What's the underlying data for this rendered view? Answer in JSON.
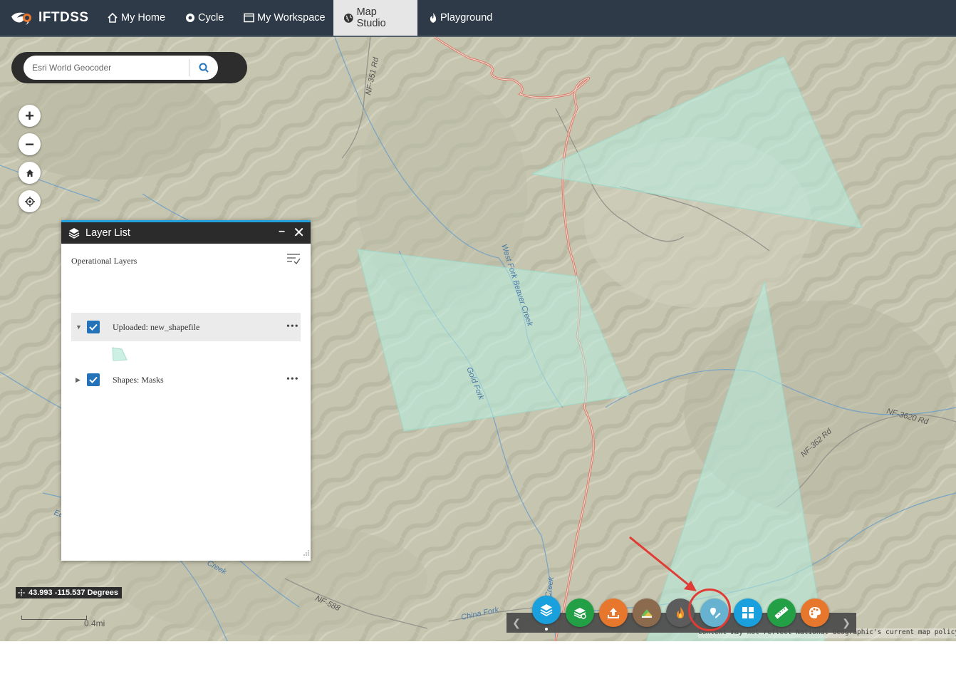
{
  "nav": {
    "brand": "IFTDSS",
    "items": [
      {
        "label": "My Home",
        "icon": "home-icon"
      },
      {
        "label": "Cycle",
        "icon": "cycle-icon"
      },
      {
        "label": "My Workspace",
        "icon": "window-icon"
      },
      {
        "label": "Map Studio",
        "icon": "globe-icon",
        "active": true
      },
      {
        "label": "Playground",
        "icon": "flame-icon"
      }
    ]
  },
  "search": {
    "placeholder": "Esri World Geocoder"
  },
  "map_controls": [
    {
      "name": "zoom-in-button",
      "glyph": "+"
    },
    {
      "name": "zoom-out-button",
      "glyph": "−"
    },
    {
      "name": "home-extent-button",
      "icon": "home-icon"
    },
    {
      "name": "locate-button",
      "icon": "locate-icon"
    }
  ],
  "layer_list": {
    "title": "Layer List",
    "subtitle": "Operational Layers",
    "layers": [
      {
        "label": "Uploaded: new_shapefile",
        "checked": true,
        "expanded": true
      },
      {
        "label": "Shapes: Masks",
        "checked": true,
        "expanded": false
      }
    ]
  },
  "map_labels": {
    "road_nf351": "NF-351 Rd",
    "creek_west_fork": "West Fork Beaver Creek",
    "creek_gold_fork": "Gold Fork",
    "road_nf3620": "NF-3620 Rd",
    "road_nf362": "NF-362 Rd",
    "road_nf588": "NF-588",
    "creek_china_fork": "China Fork",
    "creek_left_fragment": "Ea",
    "creek_bottom_left": "Creek",
    "creek_bottom_mid": "er Creek"
  },
  "coordinates": "43.993 -115.537 Degrees",
  "scale": "0.4mi",
  "attribution": "Content may not reflect National Geographic's current map policy. Sour",
  "toolbar": {
    "buttons": [
      {
        "name": "layer-list-tool-button",
        "icon": "layers-icon",
        "color": "#1aa0dc"
      },
      {
        "name": "basemap-tool-button",
        "icon": "basemap-icon",
        "color": "#23a045"
      },
      {
        "name": "upload-tool-button",
        "icon": "upload-icon",
        "color": "#e8772e"
      },
      {
        "name": "landscape-tool-button",
        "icon": "landscape-icon",
        "color": "#8b6a4e"
      },
      {
        "name": "fire-tool-button",
        "icon": "fire-icon",
        "color": "#5c5c5c"
      },
      {
        "name": "draw-tool-button",
        "icon": "draw-icon",
        "color": "#67b2d0"
      },
      {
        "name": "grid-tool-button",
        "icon": "grid-icon",
        "color": "#1aa0dc"
      },
      {
        "name": "measure-tool-button",
        "icon": "ruler-icon",
        "color": "#23a045"
      },
      {
        "name": "style-tool-button",
        "icon": "palette-icon",
        "color": "#e8772e"
      }
    ]
  }
}
